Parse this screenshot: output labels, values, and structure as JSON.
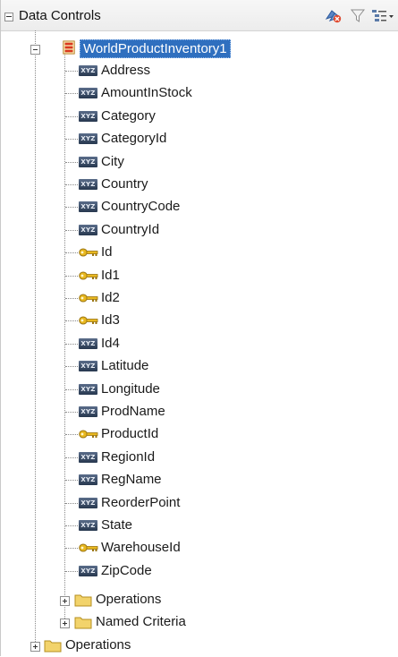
{
  "header": {
    "title": "Data Controls",
    "icons": [
      "refresh-icon",
      "filter-icon",
      "view-menu-icon"
    ]
  },
  "tree": {
    "root_item": {
      "label": "WorldProductInventory1",
      "icon": "collection-icon",
      "selected": true
    },
    "attributes": [
      {
        "label": "Address",
        "icon": "attribute-icon"
      },
      {
        "label": "AmountInStock",
        "icon": "attribute-icon"
      },
      {
        "label": "Category",
        "icon": "attribute-icon"
      },
      {
        "label": "CategoryId",
        "icon": "attribute-icon"
      },
      {
        "label": "City",
        "icon": "attribute-icon"
      },
      {
        "label": "Country",
        "icon": "attribute-icon"
      },
      {
        "label": "CountryCode",
        "icon": "attribute-icon"
      },
      {
        "label": "CountryId",
        "icon": "attribute-icon"
      },
      {
        "label": "Id",
        "icon": "key-icon"
      },
      {
        "label": "Id1",
        "icon": "key-icon"
      },
      {
        "label": "Id2",
        "icon": "key-icon"
      },
      {
        "label": "Id3",
        "icon": "key-icon"
      },
      {
        "label": "Id4",
        "icon": "attribute-icon"
      },
      {
        "label": "Latitude",
        "icon": "attribute-icon"
      },
      {
        "label": "Longitude",
        "icon": "attribute-icon"
      },
      {
        "label": "ProdName",
        "icon": "attribute-icon"
      },
      {
        "label": "ProductId",
        "icon": "key-icon"
      },
      {
        "label": "RegionId",
        "icon": "attribute-icon"
      },
      {
        "label": "RegName",
        "icon": "attribute-icon"
      },
      {
        "label": "ReorderPoint",
        "icon": "attribute-icon"
      },
      {
        "label": "State",
        "icon": "attribute-icon"
      },
      {
        "label": "WarehouseId",
        "icon": "key-icon"
      },
      {
        "label": "ZipCode",
        "icon": "attribute-icon"
      }
    ],
    "child_folders": [
      {
        "label": "Operations",
        "icon": "folder-icon"
      },
      {
        "label": "Named Criteria",
        "icon": "folder-icon"
      }
    ],
    "top_folder": {
      "label": "Operations",
      "icon": "folder-icon"
    },
    "attribute_badge_text": "XYZ"
  },
  "colors": {
    "selection": "#2f6fbf",
    "folder": "#f2d36b",
    "key": "#e8b820"
  }
}
